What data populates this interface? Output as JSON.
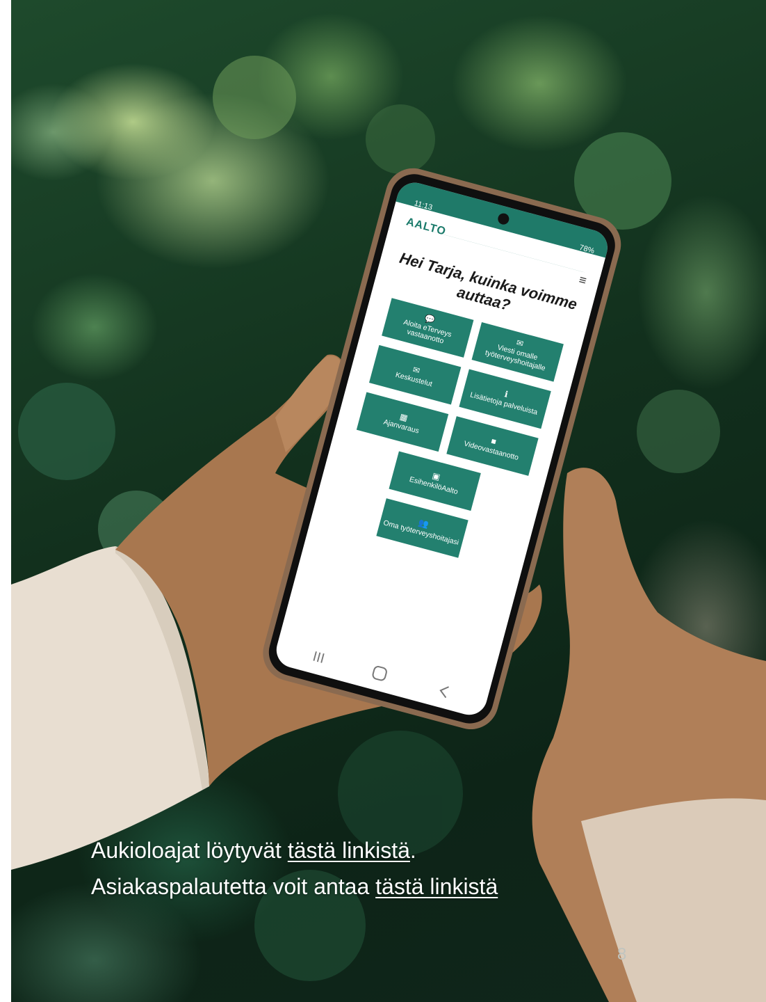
{
  "caption": {
    "line1_prefix": "Aukioloajat löytyvät ",
    "line1_link": "tästä linkistä",
    "line1_suffix": ".",
    "line2_prefix": "Asiakaspalautetta voit antaa ",
    "line2_link": "tästä linkistä"
  },
  "page_number": "8",
  "phone": {
    "status_time": "11:13",
    "status_battery": "78%",
    "app_logo": "AALTO",
    "greeting": "Hei Tarja, kuinka voimme auttaa?",
    "tiles": [
      {
        "label": "Aloita eTerveys vastaanotto",
        "icon": "chat-icon"
      },
      {
        "label": "Viesti omalle työterveyshoitajalle",
        "icon": "envelope-icon"
      },
      {
        "label": "Keskustelut",
        "icon": "envelope-icon"
      },
      {
        "label": "Lisätietoja palveluista",
        "icon": "info-icon"
      },
      {
        "label": "Ajanvaraus",
        "icon": "calendar-icon"
      },
      {
        "label": "Videovastaanotto",
        "icon": "video-camera-icon"
      },
      {
        "label": "EsihenkilöAalto",
        "icon": "archive-box-icon"
      },
      {
        "label": "Oma työterveyshoitajasi",
        "icon": "users-icon"
      }
    ]
  },
  "colors": {
    "tile_green": "#23806f",
    "foliage_dark": "#12301d",
    "caption_text": "#ffffff"
  }
}
